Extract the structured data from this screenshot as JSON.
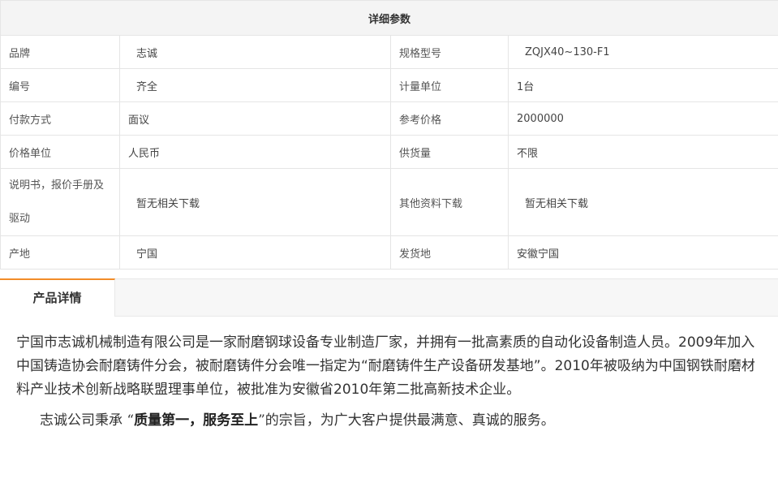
{
  "params": {
    "header": "详细参数",
    "rows": [
      {
        "l1": "品牌",
        "v1": "志诚",
        "l2": "规格型号",
        "v2": "ZQJX40~130-F1"
      },
      {
        "l1": "编号",
        "v1": "齐全",
        "l2": "计量单位",
        "v2": "1台"
      },
      {
        "l1": "付款方式",
        "v1": "面议",
        "l2": "参考价格",
        "v2": "2000000"
      },
      {
        "l1": "价格单位",
        "v1": "人民币",
        "l2": "供货量",
        "v2": "不限"
      },
      {
        "l1": "说明书，报价手册及驱动",
        "v1": "暂无相关下载",
        "l2": "其他资料下载",
        "v2": "暂无相关下载"
      },
      {
        "l1": "产地",
        "v1": "宁国",
        "l2": "发货地",
        "v2": "安徽宁国"
      }
    ]
  },
  "tabs": {
    "active_label": "产品详情"
  },
  "content": {
    "paragraph1": "宁国市志诚机械制造有限公司是一家耐磨钢球设备专业制造厂家，并拥有一批高素质的自动化设备制造人员。2009年加入中国铸造协会耐磨铸件分会，被耐磨铸件分会唯一指定为“耐磨铸件生产设备研发基地”。2010年被吸纳为中国钢铁耐磨材料产业技术创新战略联盟理事单位，被批准为安徽省2010年第二批高新技术企业。",
    "paragraph2_prefix": "志诚公司秉承 “",
    "paragraph2_bold": "质量第一，服务至上",
    "paragraph2_suffix": "”的宗旨，为广大客户提供最满意、真诚的服务。"
  }
}
